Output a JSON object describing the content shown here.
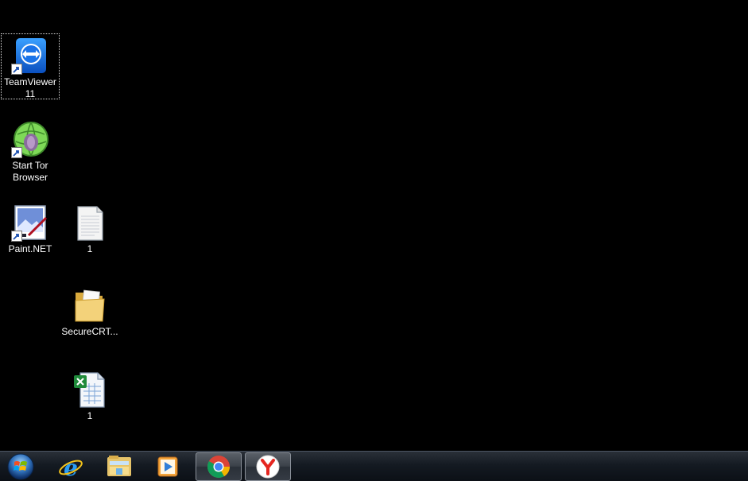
{
  "desktop": {
    "icons": [
      {
        "label": "TeamViewer\n11",
        "icon": "teamviewer-icon",
        "shortcut": true,
        "selected": true
      },
      {
        "label": "Start Tor\nBrowser",
        "icon": "tor-browser-icon",
        "shortcut": true
      },
      {
        "label": "Paint.NET",
        "icon": "paint-net-icon",
        "shortcut": true
      },
      {
        "label": "1",
        "icon": "text-file-icon"
      },
      {
        "label": "SecureCRT...",
        "icon": "folder-icon"
      },
      {
        "label": "1",
        "icon": "excel-file-icon"
      }
    ]
  },
  "taskbar": {
    "start": {
      "icon": "windows-start-orb-icon"
    },
    "items": [
      {
        "name": "Internet Explorer",
        "icon": "internet-explorer-icon"
      },
      {
        "name": "Windows Explorer",
        "icon": "file-explorer-icon"
      },
      {
        "name": "Windows Media Player",
        "icon": "media-player-icon"
      },
      {
        "name": "Google Chrome",
        "icon": "chrome-icon",
        "active": true
      },
      {
        "name": "Yandex Browser",
        "icon": "yandex-browser-icon",
        "active": true
      }
    ]
  },
  "colors": {
    "desktop_background": "#000000",
    "label_text": "#ffffff",
    "taskbar_top": "#2a3038",
    "taskbar_bottom": "#0c1016"
  }
}
